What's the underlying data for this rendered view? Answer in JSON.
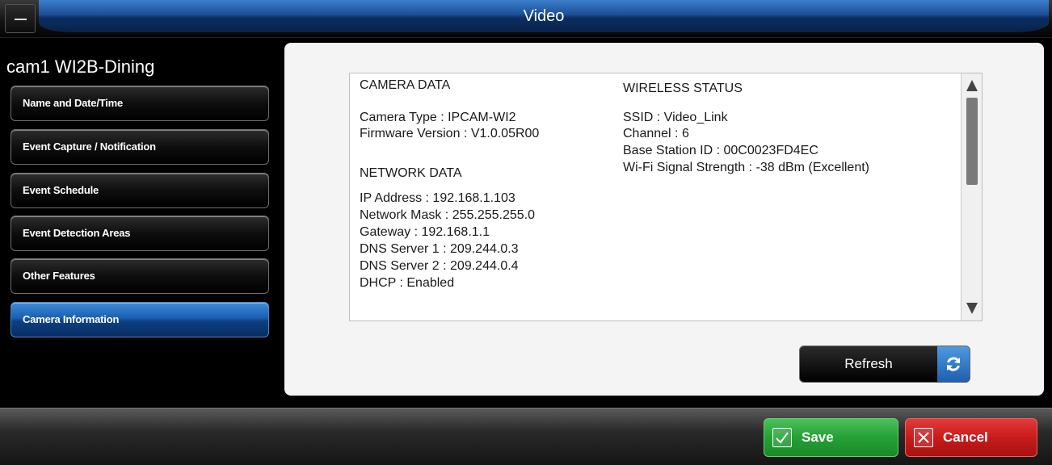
{
  "window": {
    "title": "Video"
  },
  "sidebar": {
    "device_name": "cam1 WI2B-Dining",
    "items": [
      {
        "label": "Name and Date/Time",
        "active": false
      },
      {
        "label": "Event Capture / Notification",
        "active": false
      },
      {
        "label": "Event Schedule",
        "active": false
      },
      {
        "label": "Event Detection Areas",
        "active": false
      },
      {
        "label": "Other Features",
        "active": false
      },
      {
        "label": "Camera Information",
        "active": true
      }
    ]
  },
  "camera_data": {
    "heading": "CAMERA DATA",
    "camera_type": "Camera Type : IPCAM-WI2",
    "firmware": "Firmware Version : V1.0.05R00"
  },
  "network_data": {
    "heading": "NETWORK DATA",
    "ip": "IP Address : 192.168.1.103",
    "mask": "Network Mask : 255.255.255.0",
    "gateway": "Gateway : 192.168.1.1",
    "dns1": "DNS Server 1 : 209.244.0.3",
    "dns2": "DNS Server 2 : 209.244.0.4",
    "dhcp": "DHCP : Enabled"
  },
  "wireless_status": {
    "heading": "WIRELESS STATUS",
    "ssid": "SSID : Video_Link",
    "channel": "Channel : 6",
    "base_station": "Base Station ID : 00C0023FD4EC",
    "signal": "Wi-Fi Signal Strength : -38 dBm  (Excellent)"
  },
  "buttons": {
    "refresh": "Refresh",
    "save": "Save",
    "cancel": "Cancel"
  },
  "icons": {
    "menu": "menu-icon",
    "refresh": "refresh-icon",
    "save": "checkmark-icon",
    "cancel": "close-icon"
  },
  "colors": {
    "title_accent": "#1b4f96",
    "active_nav": "#1a5fb0",
    "save": "#25a036",
    "cancel": "#c81b1b"
  }
}
